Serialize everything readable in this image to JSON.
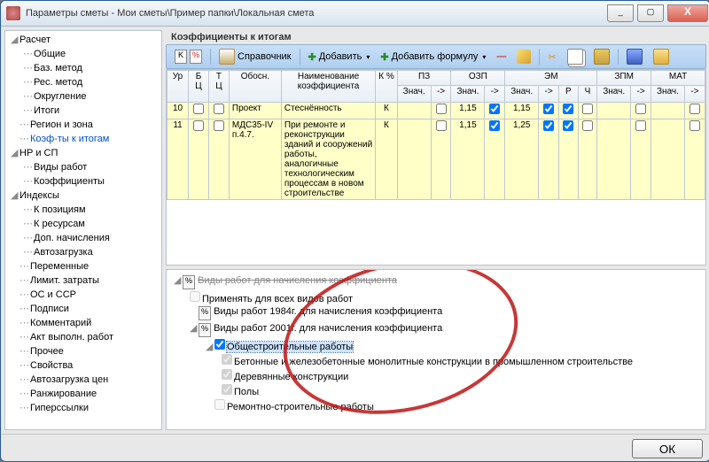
{
  "titlebar": {
    "title": "Параметры сметы - Мои сметы\\Пример папки\\Локальная смета"
  },
  "winbtns": {
    "min": "_",
    "max": "▢",
    "close": "X"
  },
  "sidebar": [
    {
      "label": "Расчет",
      "exp": true,
      "children": [
        "Общие",
        "Баз. метод",
        "Рес. метод",
        "Округление",
        "Итоги"
      ]
    },
    {
      "label": "Регион и зона"
    },
    {
      "label": "Коэф-ты к итогам",
      "sel": true
    },
    {
      "label": "НР и СП",
      "exp": true,
      "children": [
        "Виды работ",
        "Коэффициенты"
      ]
    },
    {
      "label": "Индексы",
      "exp": true,
      "children": [
        "К позициям",
        "К ресурсам",
        "Доп. начисления",
        "Автозагрузка"
      ]
    },
    {
      "label": "Переменные"
    },
    {
      "label": "Лимит. затраты"
    },
    {
      "label": "ОС и ССР"
    },
    {
      "label": "Подписи"
    },
    {
      "label": "Комментарий"
    },
    {
      "label": "Акт выполн. работ"
    },
    {
      "label": "Прочее"
    },
    {
      "label": "Свойства"
    },
    {
      "label": "Автозагрузка цен"
    },
    {
      "label": "Ранжирование"
    },
    {
      "label": "Гиперссылки"
    }
  ],
  "section_title": "Коэффициенты к итогам",
  "toolbar": {
    "ref": "Справочник",
    "add": "Добавить",
    "dd": "▾",
    "addf": "Добавить формулу"
  },
  "grid": {
    "head1": [
      "Ур",
      "БЦ",
      "ТЦ",
      "Обосн.",
      "Наименование коэффициента",
      "К %",
      "ПЗ",
      "",
      "ОЗП",
      "",
      "ЭМ",
      "",
      "",
      "",
      "ЗПМ",
      "",
      "МАТ",
      ""
    ],
    "head2": [
      "",
      "",
      "",
      "",
      "",
      "",
      "Знач.",
      "->",
      "Знач.",
      "->",
      "Знач.",
      "->",
      "Р",
      "Ч",
      "Знач.",
      "->",
      "Знач.",
      "->"
    ],
    "rows": [
      {
        "ur": "10",
        "obosn": "Проект",
        "naim": "Стеснённость",
        "kp": "К",
        "ozp": "1,15",
        "ozpc": true,
        "em": "1,15",
        "emc": true,
        "rc": true
      },
      {
        "ur": "11",
        "obosn": "МДС35-IV п.4.7.",
        "naim": "При ремонте и реконструкции зданий и сооружений работы, аналогичные технологическим процессам в новом строительстве",
        "kp": "К",
        "ozp": "1,15",
        "ozpc": true,
        "em": "1,25",
        "emc": true,
        "rc": true
      }
    ]
  },
  "bottree": {
    "root": "Виды работ для начисления коэффициента",
    "n1": "Применять для всех видов работ",
    "n2": "Виды работ 1984г. для начисления коэффициента",
    "n3": "Виды работ 2001г. для начисления коэффициента",
    "n3a": "Общестроительные работы",
    "n3a1": "Бетонные и железобетонные монолитные конструкции в промышленном строительстве",
    "n3a2": "Деревянные конструкции",
    "n3a3": "Полы",
    "n3b": "Ремонтно-строительные работы"
  },
  "ok": "ОК"
}
